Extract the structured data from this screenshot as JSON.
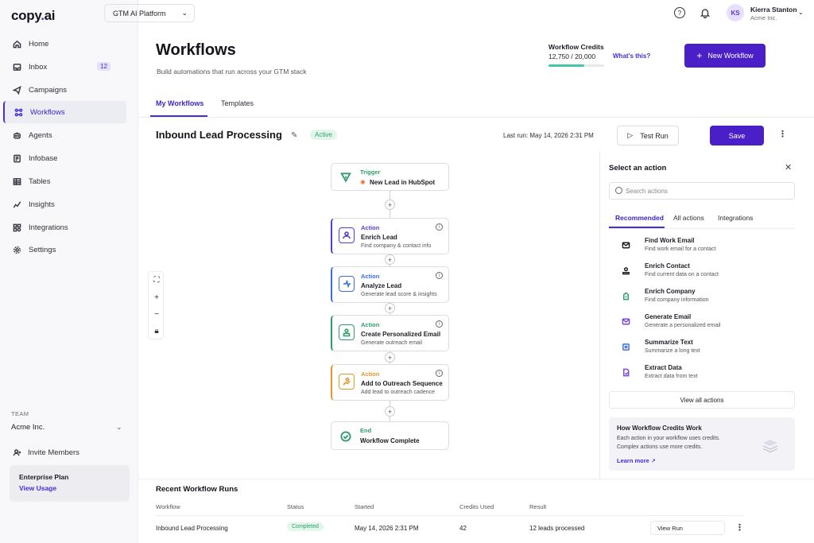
{
  "brand": {
    "logo_main": "copy",
    "logo_dot": ".",
    "logo_tail": "ai"
  },
  "sidebar": {
    "items": [
      {
        "label": "Home",
        "icon": "home-icon"
      },
      {
        "label": "Inbox",
        "icon": "inbox-icon",
        "badge": "12"
      },
      {
        "label": "Campaigns",
        "icon": "send-icon"
      },
      {
        "label": "Workflows",
        "icon": "workflow-icon",
        "active": true
      },
      {
        "label": "Agents",
        "icon": "agent-icon"
      },
      {
        "label": "Infobase",
        "icon": "database-icon"
      },
      {
        "label": "Tables",
        "icon": "table-icon"
      },
      {
        "label": "Insights",
        "icon": "chart-icon"
      },
      {
        "label": "Integrations",
        "icon": "integrations-icon"
      },
      {
        "label": "Settings",
        "icon": "gear-icon"
      }
    ],
    "team_label": "TEAM",
    "team_name": "Acme Inc.",
    "invite_label": "Invite Members",
    "plan_title": "Enterprise Plan",
    "plan_link": "View Usage"
  },
  "topbar": {
    "platform": "GTM AI Platform",
    "avatar_initials": "KS",
    "user_name": "Kierra Stanton",
    "user_org": "Acme Inc."
  },
  "header": {
    "title": "Workflows",
    "subtitle": "Build automations that run across your GTM stack",
    "credits_label": "Workflow Credits",
    "credits_value": "12,750 / 20,000",
    "credits_fraction": 0.6375,
    "whats_this": "What's this?",
    "new_workflow": "New Workflow"
  },
  "tabs": {
    "my_workflows": "My Workflows",
    "templates": "Templates"
  },
  "workflow": {
    "name": "Inbound Lead Processing",
    "status": "Active",
    "last_run": "Last run: May 14, 2026 2:31 PM",
    "test_run": "Test Run",
    "save": "Save"
  },
  "nodes": [
    {
      "kind": "Trigger",
      "name": "New Lead in HubSpot",
      "desc": "",
      "color": "#2f9d6b"
    },
    {
      "kind": "Action",
      "name": "Enrich Lead",
      "desc": "Find company & contact info",
      "color": "#5a3ad6"
    },
    {
      "kind": "Action",
      "name": "Analyze Lead",
      "desc": "Generate lead score & insights",
      "color": "#3b6fd8"
    },
    {
      "kind": "Action",
      "name": "Create Personalized Email",
      "desc": "Generate outreach email",
      "color": "#2f9d6b"
    },
    {
      "kind": "Action",
      "name": "Add to Outreach Sequence",
      "desc": "Add lead to outreach cadence",
      "color": "#e0962b"
    },
    {
      "kind": "End",
      "name": "Workflow Complete",
      "desc": "",
      "color": "#2f9d6b"
    }
  ],
  "panel": {
    "title": "Select an action",
    "search_placeholder": "Search actions",
    "tabs": [
      "Recommended",
      "All actions",
      "Integrations"
    ],
    "actions": [
      {
        "title": "Find Work Email",
        "desc": "Find work email for a contact",
        "icon": "mail-icon"
      },
      {
        "title": "Enrich Contact",
        "desc": "Find current data on a contact",
        "icon": "contact-icon"
      },
      {
        "title": "Enrich Company",
        "desc": "Find company information",
        "icon": "company-icon"
      },
      {
        "title": "Generate Email",
        "desc": "Generate a personalized email",
        "icon": "mail-generate-icon"
      },
      {
        "title": "Summarize Text",
        "desc": "Summarize a long text",
        "icon": "summarize-icon"
      },
      {
        "title": "Extract Data",
        "desc": "Extract data from text",
        "icon": "extract-icon"
      }
    ],
    "view_all": "View all actions",
    "help_title": "How Workflow Credits Work",
    "help_body": "Each action in your workflow uses credits. Complex actions use more credits.",
    "help_link": "Learn more"
  },
  "runs": {
    "title": "Recent Workflow Runs",
    "headers": [
      "Workflow",
      "Status",
      "Started",
      "Credits Used",
      "Result"
    ],
    "rows": [
      {
        "workflow": "Inbound Lead Processing",
        "status": "Completed",
        "started": "May 14, 2026 2:31 PM",
        "credits": "42",
        "result": "12 leads processed",
        "action": "View Run"
      }
    ]
  }
}
